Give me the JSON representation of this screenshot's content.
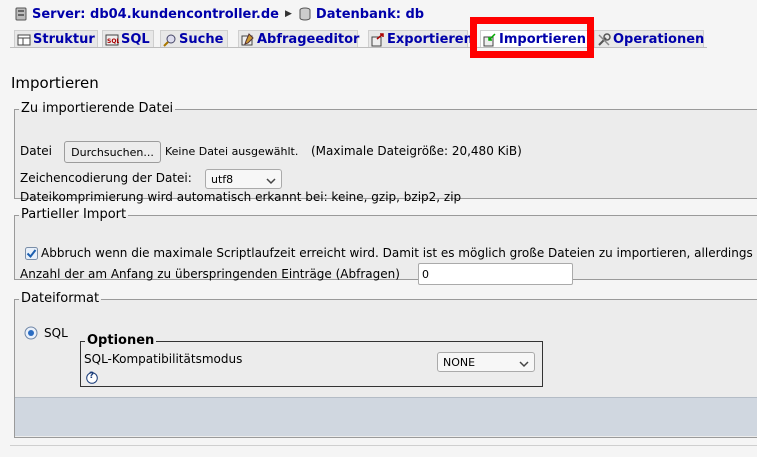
{
  "breadcrumb": {
    "server_label": "Server: db04.kundencontroller.de",
    "database_label": "Datenbank: db"
  },
  "tabs": [
    {
      "label": "Struktur"
    },
    {
      "label": "SQL"
    },
    {
      "label": "Suche"
    },
    {
      "label": "Abfrageeditor"
    },
    {
      "label": "Exportieren"
    },
    {
      "label": "Importieren"
    },
    {
      "label": "Operationen"
    }
  ],
  "active_tab": "Importieren",
  "page_title": "Importieren",
  "file_section": {
    "legend": "Zu importierende Datei",
    "file_label": "Datei",
    "browse_button": "Durchsuchen...",
    "no_file_text": "Keine Datei ausgewählt.",
    "max_size_text": "(Maximale Dateigröße: 20,480 KiB)",
    "charset_label": "Zeichencodierung der Datei:",
    "charset_value": "utf8",
    "compression_text": "Dateikomprimierung wird automatisch erkannt bei: keine, gzip, bzip2, zip"
  },
  "partial_section": {
    "legend": "Partieller Import",
    "abort_checkbox_label": "Abbruch wenn die maximale Scriptlaufzeit erreicht wird. Damit ist es möglich große Dateien zu importieren, allerdings",
    "abort_checked": true,
    "skip_label": "Anzahl der am Anfang zu überspringenden Einträge (Abfragen)",
    "skip_value": "0"
  },
  "format_section": {
    "legend": "Dateiformat",
    "sql_radio_label": "SQL",
    "sql_selected": true,
    "options_legend": "Optionen",
    "compat_label": "SQL-Kompatibilitätsmodus",
    "compat_value": "NONE",
    "help_icon": "?"
  },
  "colors": {
    "link": "#0000aa",
    "highlight": "#ff0000",
    "footer_band": "#d0d7e0"
  }
}
